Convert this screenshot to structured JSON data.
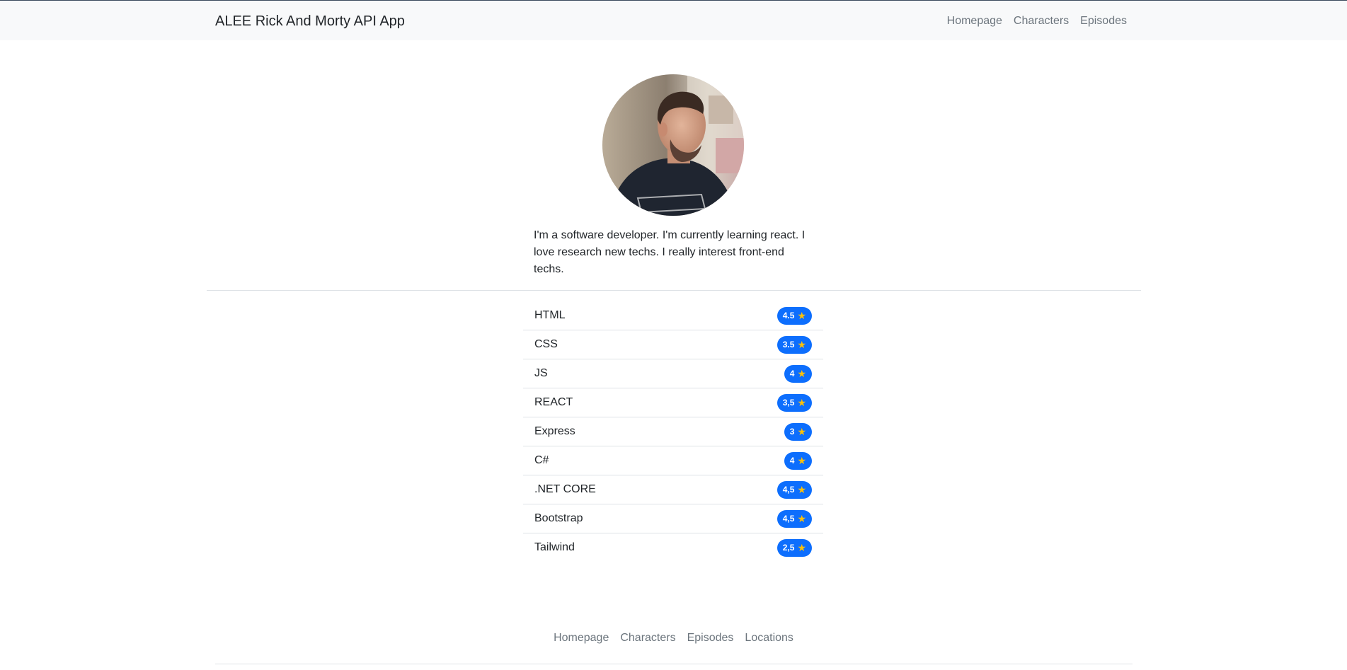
{
  "navbar": {
    "brand": "ALEE Rick And Morty API App",
    "links": [
      "Homepage",
      "Characters",
      "Episodes"
    ]
  },
  "profile": {
    "bio": "I'm a software developer. I'm currently learning react. I love research new techs. I really interest front-end techs."
  },
  "skills": [
    {
      "name": "HTML",
      "rating": "4.5"
    },
    {
      "name": "CSS",
      "rating": "3.5"
    },
    {
      "name": "JS",
      "rating": "4"
    },
    {
      "name": "REACT",
      "rating": "3,5"
    },
    {
      "name": "Express",
      "rating": "3"
    },
    {
      "name": "C#",
      "rating": "4"
    },
    {
      "name": ".NET CORE",
      "rating": "4,5"
    },
    {
      "name": "Bootstrap",
      "rating": "4,5"
    },
    {
      "name": "Tailwind",
      "rating": "2,5"
    }
  ],
  "footer": {
    "links": [
      "Homepage",
      "Characters",
      "Episodes",
      "Locations"
    ]
  },
  "colors": {
    "badge": "#0d6efd",
    "star": "#ffc107",
    "navbar_bg": "#f8f9fa",
    "link": "#6c757d"
  },
  "icons": {
    "rating_icon": "star-icon"
  }
}
